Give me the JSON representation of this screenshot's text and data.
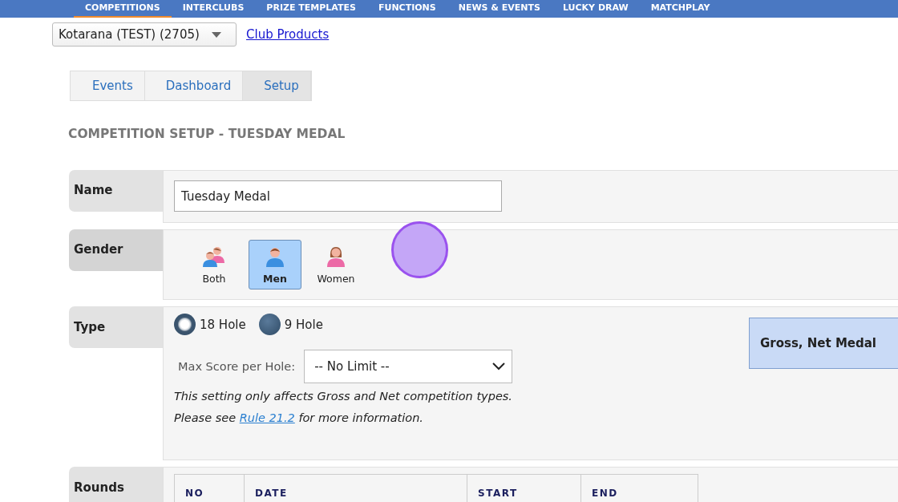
{
  "nav": [
    {
      "label": "COMPETITIONS",
      "selected": true
    },
    {
      "label": "INTERCLUBS",
      "selected": false
    },
    {
      "label": "PRIZE TEMPLATES",
      "selected": false
    },
    {
      "label": "FUNCTIONS",
      "selected": false
    },
    {
      "label": "NEWS & EVENTS",
      "selected": false
    },
    {
      "label": "LUCKY DRAW",
      "selected": false
    },
    {
      "label": "MATCHPLAY",
      "selected": false
    }
  ],
  "club_select": {
    "value": "Kotarana (TEST) (2705)"
  },
  "club_link": "Club Products",
  "breadcrumbs": [
    {
      "label": "Events",
      "selected": false
    },
    {
      "label": "Dashboard",
      "selected": false
    },
    {
      "label": "Setup",
      "selected": true
    }
  ],
  "heading": "COMPETITION SETUP - TUESDAY MEDAL",
  "name": {
    "label": "Name",
    "value": "Tuesday Medal"
  },
  "gender": {
    "label": "Gender",
    "options": [
      {
        "label": "Both",
        "kind": "both",
        "selected": false
      },
      {
        "label": "Men",
        "kind": "men",
        "selected": true
      },
      {
        "label": "Women",
        "kind": "women",
        "selected": false
      }
    ]
  },
  "type": {
    "label": "Type",
    "holes": [
      {
        "label": "18 Hole",
        "selected": true
      },
      {
        "label": "9 Hole",
        "selected": false
      }
    ],
    "max_score_label": "Max Score per Hole:",
    "max_score_value": "-- No Limit --",
    "note_1": "This setting only affects Gross and Net competition types.",
    "note_2_before": "Please see",
    "note_link": "Rule 21.2",
    "note_2_after": "for more information.",
    "competition_type": "Gross, Net Medal"
  },
  "rounds": {
    "label": "Rounds",
    "columns": [
      "NO",
      "DATE",
      "START",
      "END"
    ]
  }
}
